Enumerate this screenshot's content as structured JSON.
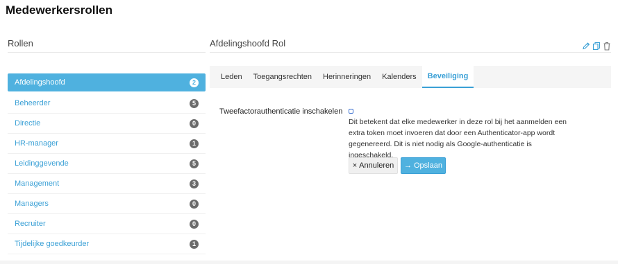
{
  "page": {
    "title": "Medewerkersrollen"
  },
  "left": {
    "heading": "Rollen",
    "roles": [
      {
        "label": "Afdelingshoofd",
        "count": "2",
        "active": true
      },
      {
        "label": "Beheerder",
        "count": "5"
      },
      {
        "label": "Directie",
        "count": "0"
      },
      {
        "label": "HR-manager",
        "count": "1"
      },
      {
        "label": "Leidinggevende",
        "count": "5"
      },
      {
        "label": "Management",
        "count": "3"
      },
      {
        "label": "Managers",
        "count": "0"
      },
      {
        "label": "Recruiter",
        "count": "0"
      },
      {
        "label": "Tijdelijke goedkeurder",
        "count": "1"
      }
    ]
  },
  "right": {
    "heading": "Afdelingshoofd Rol",
    "icons": [
      "pencil-icon",
      "copy-icon",
      "trash-icon"
    ],
    "tabs": [
      {
        "label": "Leden"
      },
      {
        "label": "Toegangsrechten"
      },
      {
        "label": "Herinneringen"
      },
      {
        "label": "Kalenders"
      },
      {
        "label": "Beveiliging",
        "active": true
      }
    ],
    "setting": {
      "label": "Tweefactorauthenticatie inschakelen",
      "checked": false,
      "description": "Dit betekent dat elke medewerker in deze rol bij het aanmelden een extra token moet invoeren dat door een Authenticator-app wordt gegenereerd. Dit is niet nodig als Google-authenticatie is ingeschakeld."
    },
    "buttons": {
      "cancel_glyph": "×",
      "cancel": "Annuleren",
      "save_glyph": "→",
      "save": "Opslaan"
    }
  },
  "colors": {
    "accent": "#4fb1df",
    "link": "#3aa0d6",
    "badge": "#6b6b6b"
  }
}
